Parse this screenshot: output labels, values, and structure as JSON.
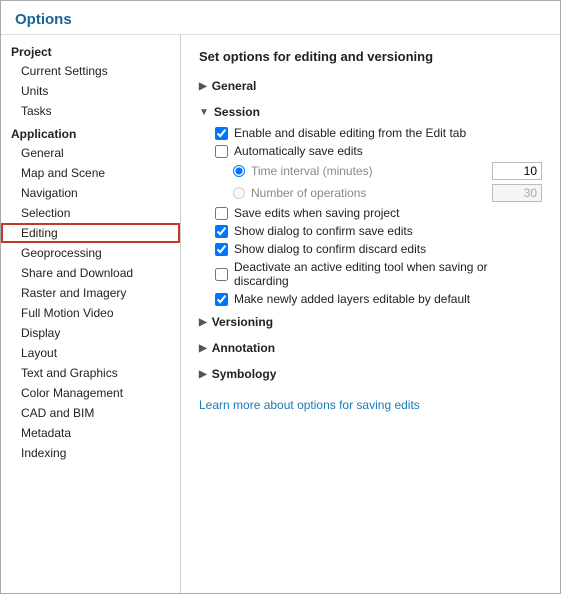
{
  "window": {
    "title": "Options"
  },
  "sidebar": {
    "groups": [
      {
        "label": "Project",
        "items": [
          {
            "id": "current-settings",
            "label": "Current Settings",
            "selected": false
          },
          {
            "id": "units",
            "label": "Units",
            "selected": false
          },
          {
            "id": "tasks",
            "label": "Tasks",
            "selected": false
          }
        ]
      },
      {
        "label": "Application",
        "items": [
          {
            "id": "general",
            "label": "General",
            "selected": false
          },
          {
            "id": "map-and-scene",
            "label": "Map and Scene",
            "selected": false
          },
          {
            "id": "navigation",
            "label": "Navigation",
            "selected": false
          },
          {
            "id": "selection",
            "label": "Selection",
            "selected": false
          },
          {
            "id": "editing",
            "label": "Editing",
            "selected": true
          },
          {
            "id": "geoprocessing",
            "label": "Geoprocessing",
            "selected": false
          },
          {
            "id": "share-and-download",
            "label": "Share and Download",
            "selected": false
          },
          {
            "id": "raster-and-imagery",
            "label": "Raster and Imagery",
            "selected": false
          },
          {
            "id": "full-motion-video",
            "label": "Full Motion Video",
            "selected": false
          },
          {
            "id": "display",
            "label": "Display",
            "selected": false
          },
          {
            "id": "layout",
            "label": "Layout",
            "selected": false
          },
          {
            "id": "text-and-graphics",
            "label": "Text and Graphics",
            "selected": false
          },
          {
            "id": "color-management",
            "label": "Color Management",
            "selected": false
          },
          {
            "id": "cad-and-bim",
            "label": "CAD and BIM",
            "selected": false
          },
          {
            "id": "metadata",
            "label": "Metadata",
            "selected": false
          },
          {
            "id": "indexing",
            "label": "Indexing",
            "selected": false
          }
        ]
      }
    ]
  },
  "main": {
    "title": "Set options for editing and versioning",
    "sections": {
      "general": {
        "label": "General",
        "collapsed": true,
        "chevron": "▶"
      },
      "session": {
        "label": "Session",
        "collapsed": false,
        "chevron": "▼",
        "checkboxes": [
          {
            "id": "enable-disable-editing",
            "label": "Enable and disable editing from the Edit tab",
            "checked": true
          },
          {
            "id": "auto-save-edits",
            "label": "Automatically save edits",
            "checked": false
          }
        ],
        "radios": [
          {
            "id": "time-interval",
            "label": "Time interval (minutes)",
            "checked": true,
            "value": "10",
            "enabled": true
          },
          {
            "id": "num-operations",
            "label": "Number of operations",
            "checked": false,
            "value": "30",
            "enabled": false
          }
        ],
        "checkboxes2": [
          {
            "id": "save-edits-saving",
            "label": "Save edits when saving project",
            "checked": false
          },
          {
            "id": "show-confirm-save",
            "label": "Show dialog to confirm save edits",
            "checked": true
          },
          {
            "id": "show-confirm-discard",
            "label": "Show dialog to confirm discard edits",
            "checked": true
          },
          {
            "id": "deactivate-tool",
            "label": "Deactivate an active editing tool when saving or discarding",
            "checked": false
          },
          {
            "id": "make-layers-editable",
            "label": "Make newly added layers editable by default",
            "checked": true
          }
        ]
      },
      "versioning": {
        "label": "Versioning",
        "collapsed": true,
        "chevron": "▶"
      },
      "annotation": {
        "label": "Annotation",
        "collapsed": true,
        "chevron": "▶"
      },
      "symbology": {
        "label": "Symbology",
        "collapsed": true,
        "chevron": "▶"
      }
    },
    "learn_more": "Learn more about options for saving edits"
  },
  "colors": {
    "selected_border": "#c0392b",
    "link": "#1a7ab8",
    "title": "#1a6496"
  }
}
